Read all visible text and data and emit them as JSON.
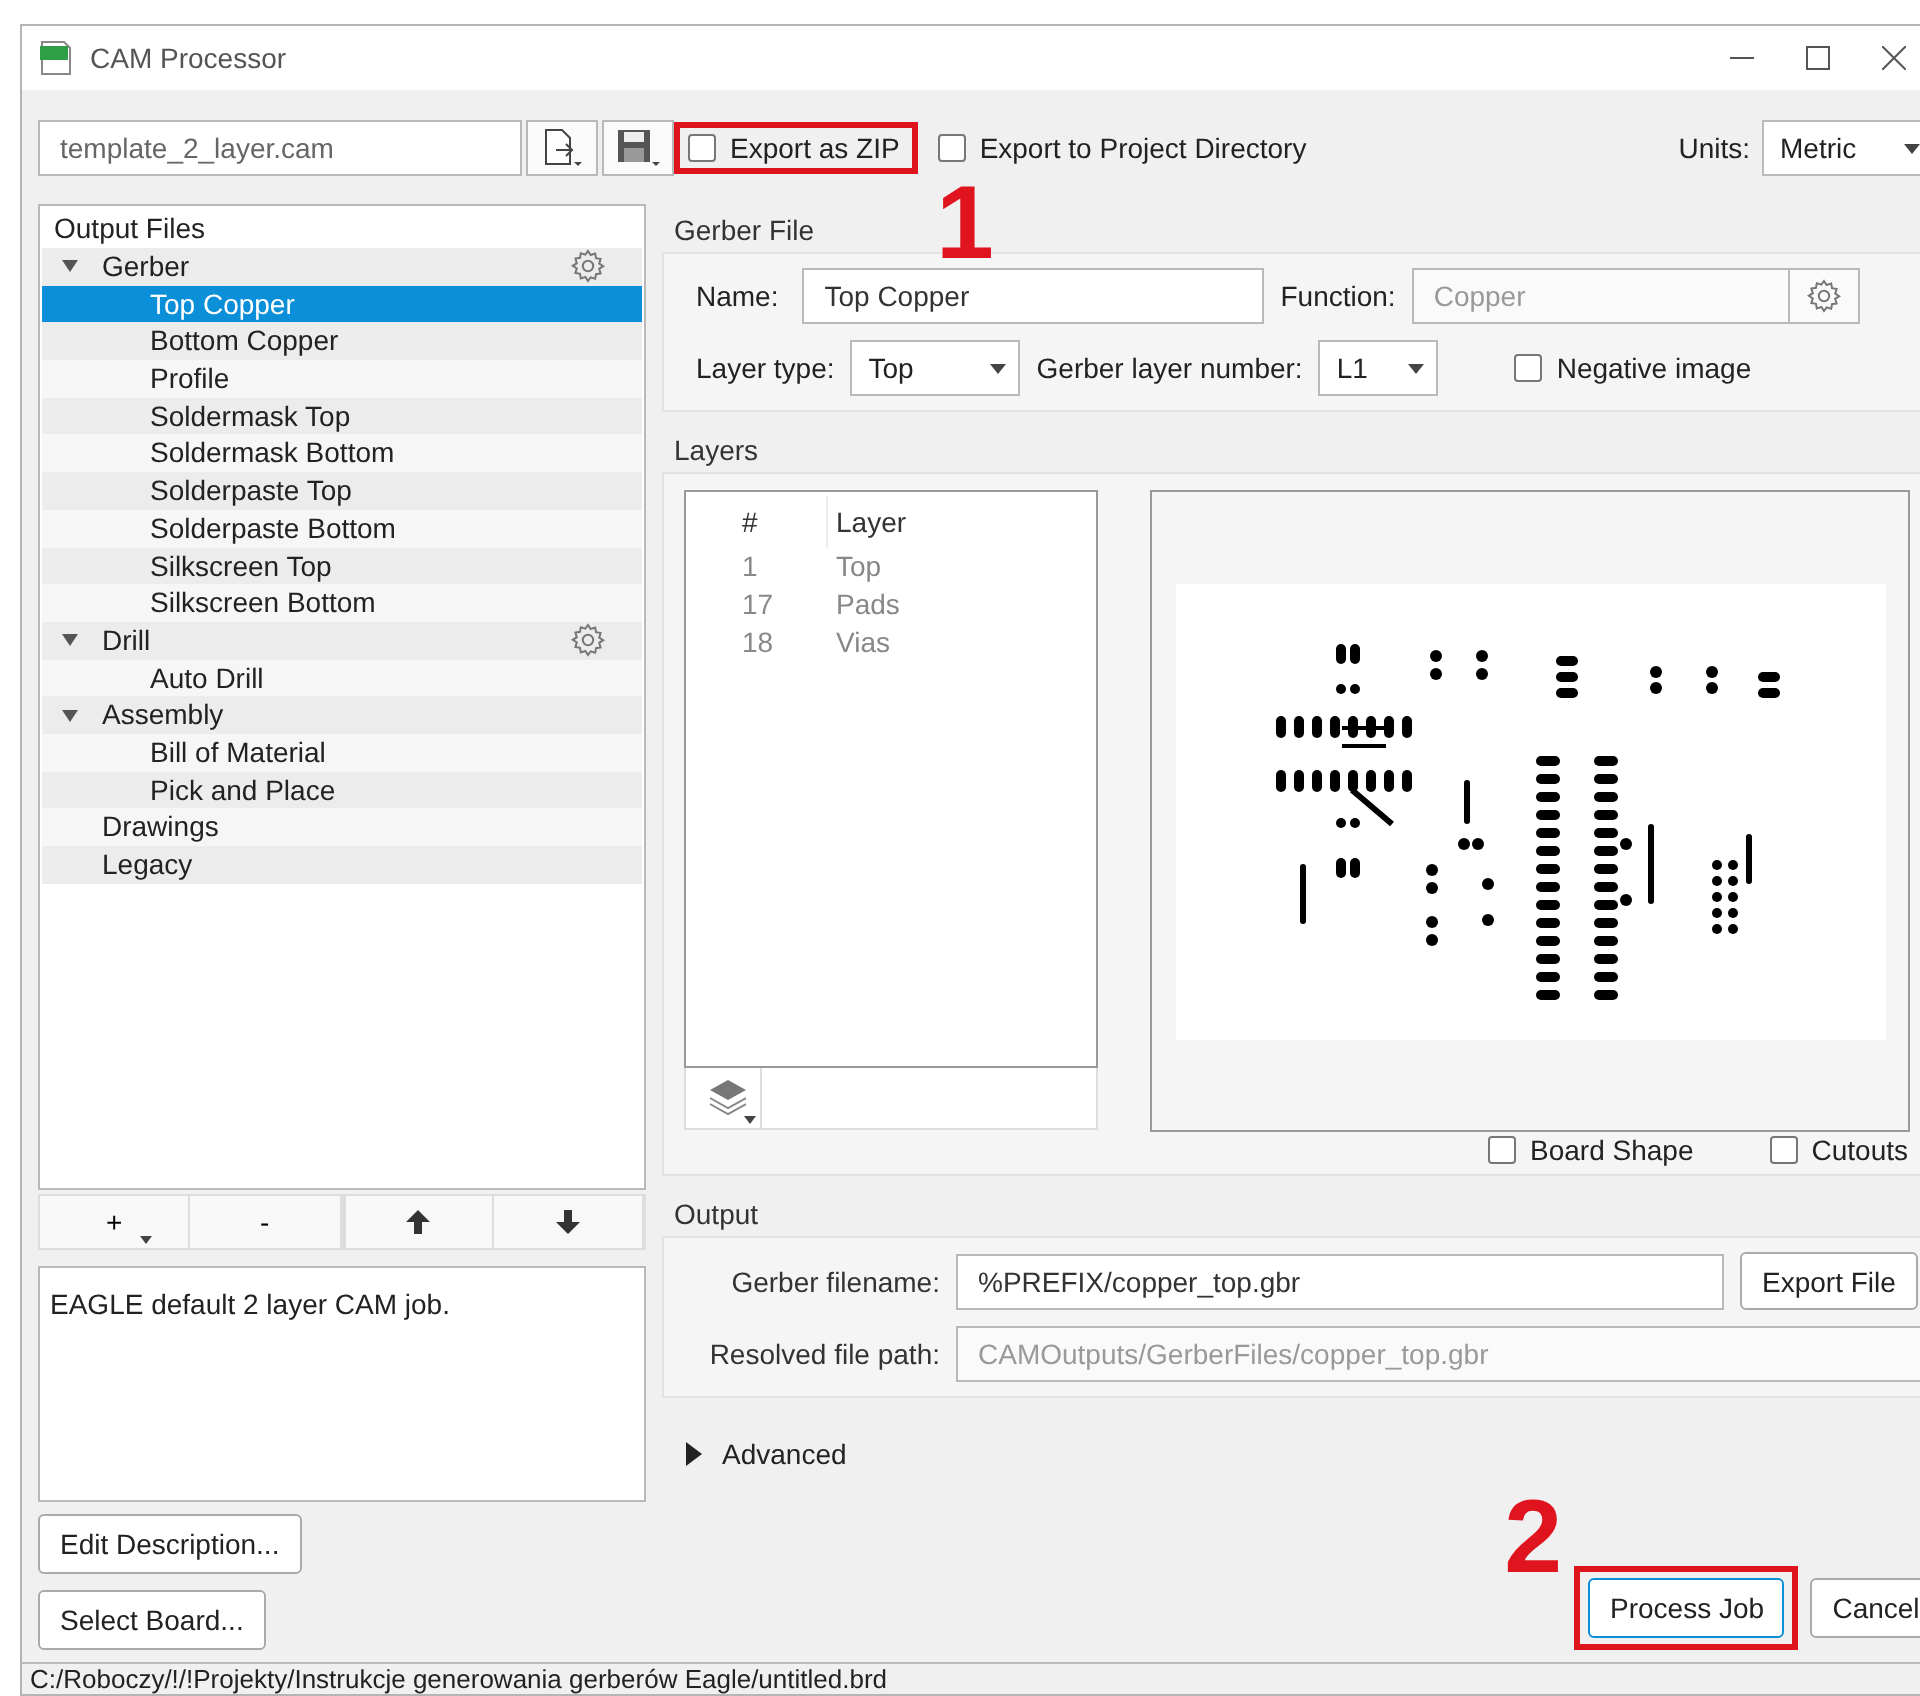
{
  "window": {
    "title": "CAM Processor"
  },
  "toolbar": {
    "job_file": "template_2_layer.cam",
    "export_zip": {
      "label": "Export as ZIP",
      "checked": false
    },
    "export_project": {
      "label": "Export to Project Directory",
      "checked": false
    },
    "units_label": "Units:",
    "units": "Metric"
  },
  "output_files": {
    "title": "Output Files",
    "items": [
      {
        "label": "Gerber",
        "expanded": true,
        "selected": false,
        "gear": true,
        "children": [
          {
            "label": "Top Copper",
            "selected": true
          },
          {
            "label": "Bottom Copper",
            "selected": false
          },
          {
            "label": "Profile",
            "selected": false
          },
          {
            "label": "Soldermask Top",
            "selected": false
          },
          {
            "label": "Soldermask Bottom",
            "selected": false
          },
          {
            "label": "Solderpaste Top",
            "selected": false
          },
          {
            "label": "Solderpaste Bottom",
            "selected": false
          },
          {
            "label": "Silkscreen Top",
            "selected": false
          },
          {
            "label": "Silkscreen Bottom",
            "selected": false
          }
        ]
      },
      {
        "label": "Drill",
        "expanded": true,
        "selected": false,
        "gear": true,
        "children": [
          {
            "label": "Auto Drill",
            "selected": false
          }
        ]
      },
      {
        "label": "Assembly",
        "expanded": true,
        "selected": false,
        "gear": false,
        "children": [
          {
            "label": "Bill of Material",
            "selected": false
          },
          {
            "label": "Pick and Place",
            "selected": false
          }
        ]
      },
      {
        "label": "Drawings",
        "selected": false,
        "gear": false
      },
      {
        "label": "Legacy",
        "selected": false,
        "gear": false
      }
    ]
  },
  "list_buttons": [
    "+",
    "-"
  ],
  "description": "EAGLE default 2 layer CAM job.",
  "left_buttons": [
    "Edit Description...",
    "Select Board..."
  ],
  "gerber_file": {
    "heading": "Gerber File",
    "name_label": "Name:",
    "name": "Top Copper",
    "function_label": "Function:",
    "function": "Copper",
    "layer_type_label": "Layer type:",
    "layer_type": "Top",
    "layer_number_label": "Gerber layer number:",
    "layer_number": "L1",
    "negative": {
      "label": "Negative image",
      "checked": false
    }
  },
  "layers": {
    "heading": "Layers",
    "columns": [
      "#",
      "Layer"
    ],
    "rows": [
      {
        "number": "1",
        "name": "Top"
      },
      {
        "number": "17",
        "name": "Pads"
      },
      {
        "number": "18",
        "name": "Vias"
      }
    ],
    "board_shape": {
      "label": "Board Shape",
      "checked": false
    },
    "cutouts": {
      "label": "Cutouts",
      "checked": false
    }
  },
  "output": {
    "heading": "Output",
    "filename_label": "Gerber filename:",
    "filename": "%PREFIX/copper_top.gbr",
    "export_button": "Export File",
    "resolved_label": "Resolved file path:",
    "resolved": "CAMOutputs/GerberFiles/copper_top.gbr"
  },
  "advanced": {
    "label": "Advanced",
    "expanded": false
  },
  "buttons": [
    "Process Job",
    "Cancel"
  ],
  "annotations": [
    "1",
    "2"
  ],
  "status_bar": "C:/Roboczy/!/!Projekty/Instrukcje generowania gerberów Eagle/untitled.brd"
}
